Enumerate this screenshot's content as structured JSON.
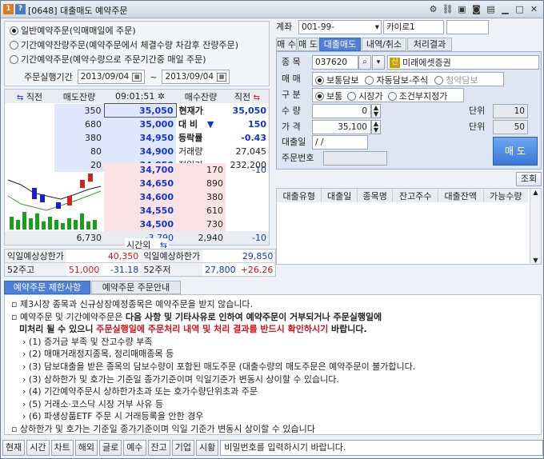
{
  "window": {
    "badge1": "1",
    "badge2": "?",
    "title": "[0648] 대출매도 예약주문"
  },
  "order_type": {
    "options": [
      "일반예약주문(익매매일에 주문)",
      "기간예약잔량주문(예약주문에서 체결수량 차감후 잔량주문)",
      "기간예약주문(예약수량으로 주문기간중 매일 주문)"
    ],
    "selected": 0,
    "period_label": "주문실행기간",
    "date_from": "2013/09/04",
    "date_sep": "~",
    "date_to": "2013/09/04"
  },
  "orderbook": {
    "head": {
      "col1": "직전",
      "col2": "매도잔량",
      "time": "09:01:51",
      "col4": "매수잔량",
      "col5": "직전"
    },
    "asks": [
      {
        "qty": "350",
        "price": "35,050"
      },
      {
        "qty": "680",
        "price": "35,000"
      },
      {
        "qty": "380",
        "price": "34,950"
      },
      {
        "qty": "80",
        "price": "34,900"
      },
      {
        "qty": "20",
        "price": "34,850"
      }
    ],
    "info": [
      {
        "label": "현재가",
        "value": "35,050"
      },
      {
        "label": "대 비",
        "arrow": "▼",
        "value": "150"
      },
      {
        "label": "등락률",
        "value": "-0.43"
      },
      {
        "label": "거래량",
        "value": "27,045"
      },
      {
        "label": "전일거",
        "value": "232,200"
      }
    ],
    "bids": [
      {
        "price": "34,700",
        "qty": "170",
        "prev": "-10"
      },
      {
        "price": "34,650",
        "qty": "890",
        "prev": ""
      },
      {
        "price": "34,600",
        "qty": "380",
        "prev": ""
      },
      {
        "price": "34,550",
        "qty": "610",
        "prev": ""
      },
      {
        "price": "34,500",
        "qty": "730",
        "prev": ""
      }
    ],
    "total_ask": "6,730",
    "diff": "-3,790",
    "total_bid": "2,940",
    "total_prev": "-10",
    "after_hours": "시간외"
  },
  "limits": {
    "upper_label": "익일예상상한가",
    "upper_value": "40,350",
    "lower_label": "익일예상하한가",
    "lower_value": "29,850",
    "high52_label": "52주고",
    "high52_value": "51,000",
    "high52_pct": "-31.18",
    "low52_label": "52주저",
    "low52_value": "27,800",
    "low52_pct": "+26.26"
  },
  "account": {
    "label": "계좌",
    "number": "001-99-",
    "name": "카이로1",
    "password": ""
  },
  "tabs": [
    "매 수",
    "매 도",
    "대출매도",
    "내역/취소",
    "처리결과"
  ],
  "active_tab": 2,
  "form": {
    "stock_label": "종 목",
    "stock_code": "037620",
    "stock_badge": "신",
    "stock_name": "미래에셋증권",
    "trade_label": "매 매",
    "trade_options": [
      "보통담보",
      "자동담보-주식",
      "청약담보"
    ],
    "type_label": "구 분",
    "type_options": [
      "보통",
      "시장가",
      "조건부지정가"
    ],
    "qty_label": "수 량",
    "qty_value": "0",
    "unit_label": "단위",
    "unit_qty": "10",
    "price_label": "가 격",
    "price_value": "35,100",
    "unit_price": "50",
    "loan_date_label": "대출일",
    "loan_date_value": "/ /",
    "order_no_label": "주문번호",
    "order_no_value": "",
    "sell_button": "매 도"
  },
  "loan_table": {
    "query_button": "조회",
    "headers": [
      "대출유형",
      "대출일",
      "종목명",
      "잔고주수",
      "대출잔액",
      "가능수량"
    ]
  },
  "notice_tabs": [
    "예약주문 제한사항",
    "예약주문 주문안내"
  ],
  "notice": {
    "line1": "제3시장 종목과 신규상장예정종목은 예약주문을 받지 않습니다.",
    "line2a": "예약주문 및 기간예약주문은 ",
    "line2b": "다음 사항 및 기타사유로 인하여 예약주문이 거부되거나 주문실행일에",
    "line3a": "미처리 될 수 있으니 ",
    "line3b": "주문실행일에 주문처리 내역 및 처리 결과를 반드시 확인하시기",
    "line3c": " 바랍니다.",
    "items": [
      "(1) 증거금 부족 및 잔고수량 부족",
      "(2) 매매거래정지종목, 정리매매종목 등",
      "(3) 담보대출을 받은 종목의 담보수량이 포함된 매도주문 (대출수량의 매도주문은 예약주문이 불가합니다.",
      "(3) 상하한가 및 호가는 기준일 종가기준이며 익일기준가 변동시 상이할 수 있습니다.",
      "(4) 기간예약주문시 상하한가초과 또는 호가수량단위초과 주문",
      "(5) 거래소·코스닥 시장 거부 사유 등",
      "(6) 파생상품ETF 주문 시 거래등록을 안한 경우"
    ],
    "footer": "상하한가 및 호가는 기준일 종가기준이며 익일 기준가 변동시 상이할 수 있습니다"
  },
  "bottom_buttons": [
    "현재",
    "시간",
    "차트",
    "해외",
    "글로",
    "예수",
    "잔고",
    "기업",
    "시황"
  ],
  "status_message": "비밀번호를 입력하시기 바랍니다."
}
